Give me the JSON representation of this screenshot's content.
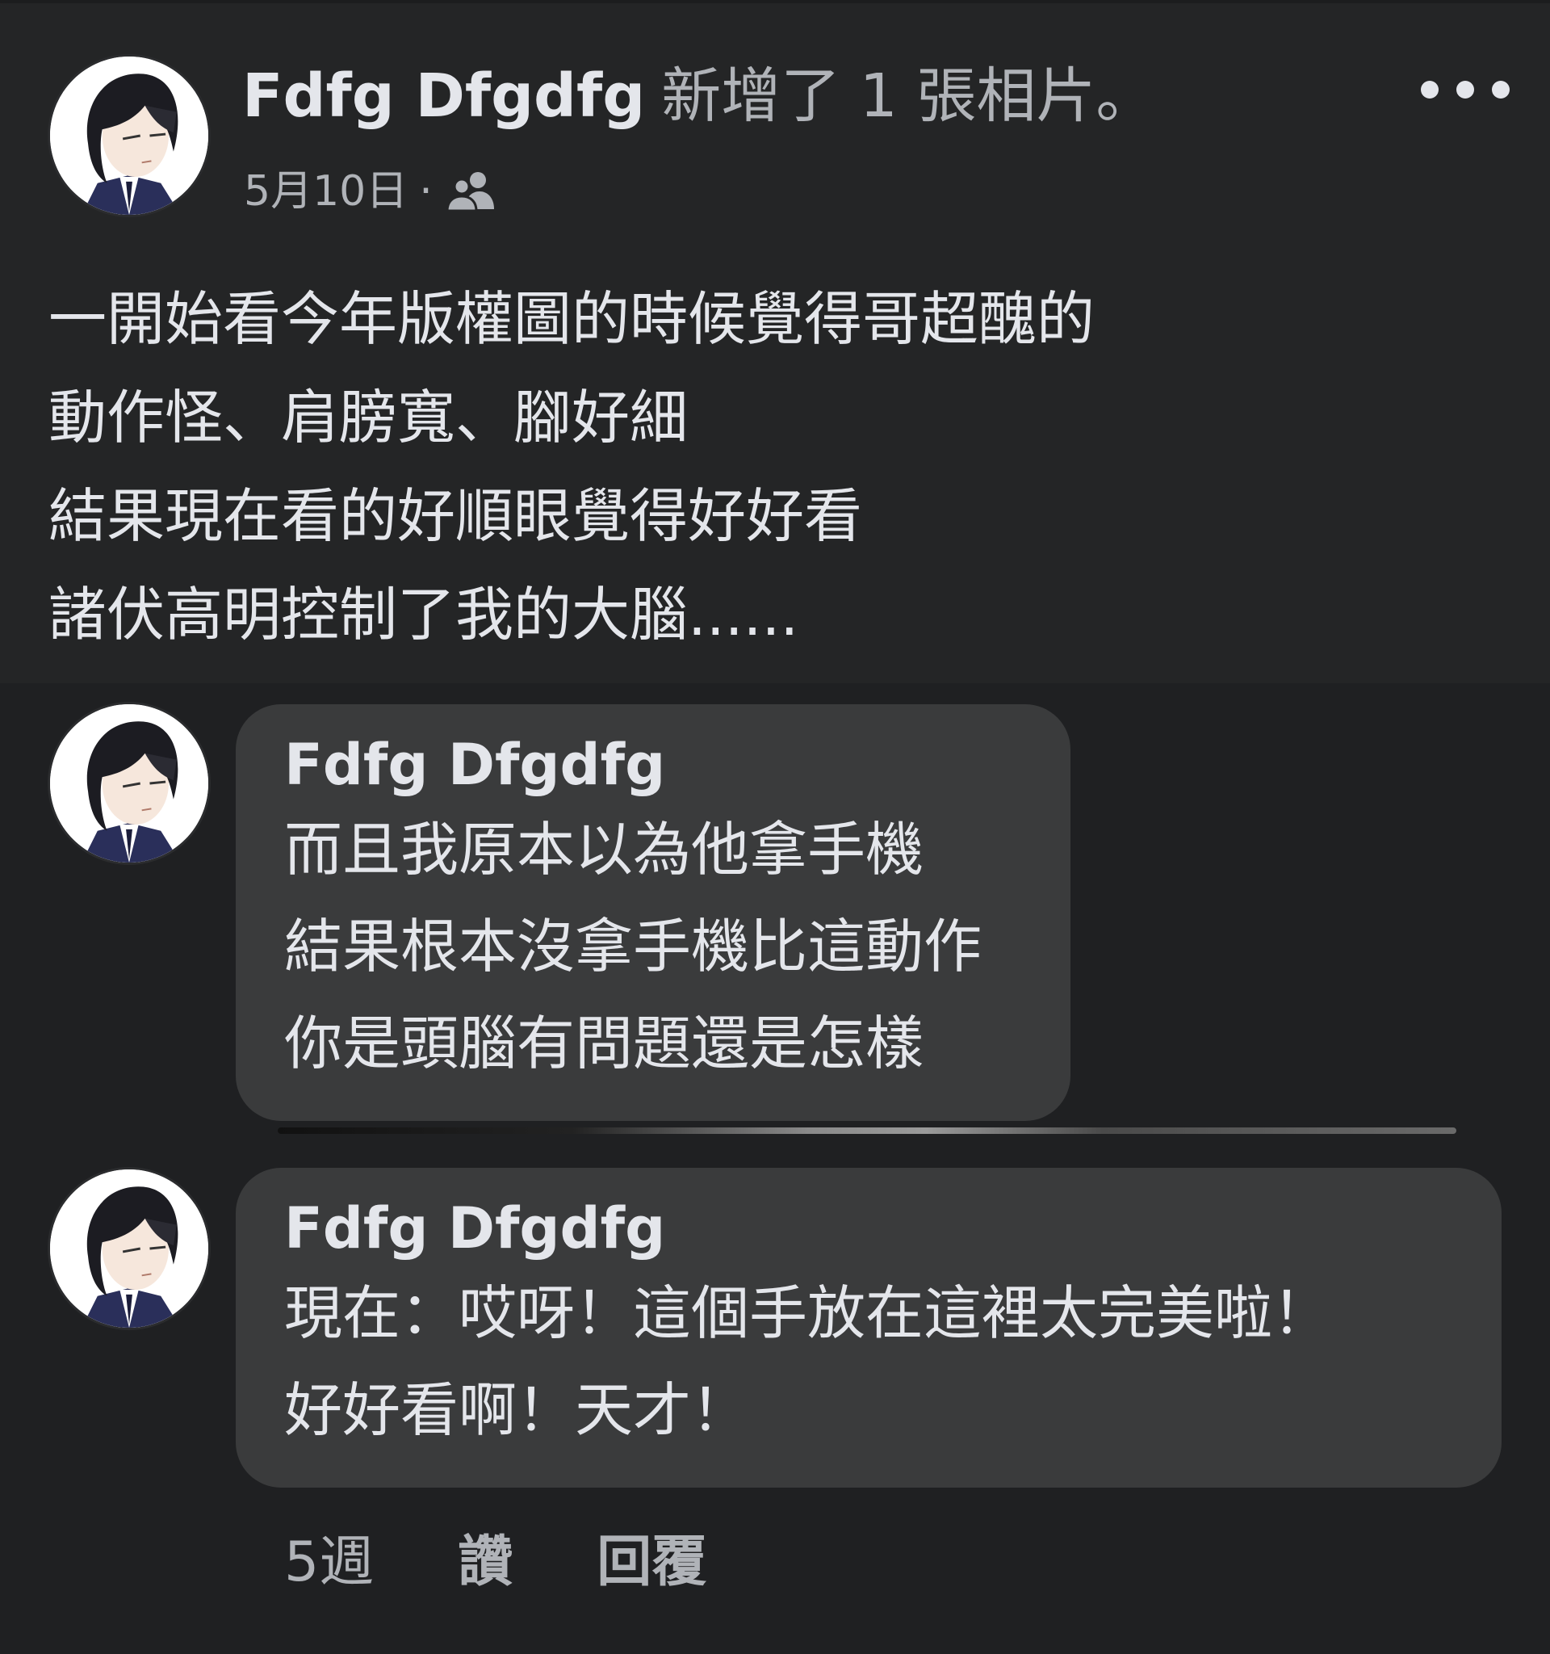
{
  "post": {
    "author": "Fdfg Dfgdfg",
    "action": "新增了 1 張相片。",
    "date": "5月10日",
    "separator": "·",
    "audience_icon": "friends-icon",
    "more_icon": "more-options-icon",
    "lines": [
      "一開始看今年版權圖的時候覺得哥超醜的",
      "動作怪、肩膀寬、腳好細",
      "結果現在看的好順眼覺得好好看",
      "諸伏高明控制了我的大腦......"
    ]
  },
  "comments": [
    {
      "author": "Fdfg Dfgdfg",
      "lines": [
        "而且我原本以為他拿手機",
        "結果根本沒拿手機比這動作",
        "你是頭腦有問題還是怎樣"
      ]
    },
    {
      "author": "Fdfg Dfgdfg",
      "lines": [
        "現在：哎呀！這個手放在這裡太完美啦！",
        "好好看啊！天才！"
      ],
      "time": "5週",
      "like_label": "讚",
      "reply_label": "回覆"
    }
  ],
  "colors": {
    "background": "#18191a",
    "card": "#242526",
    "bubble": "#3a3b3c",
    "primary_text": "#e4e6eb",
    "secondary_text": "#b0b3b8"
  }
}
